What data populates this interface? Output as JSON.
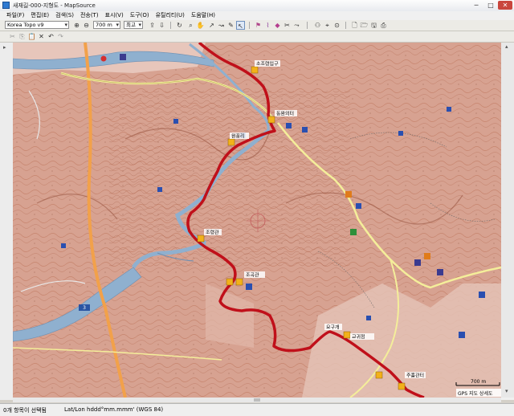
{
  "window": {
    "title": "새재길-000-지형도 - MapSource",
    "min": "─",
    "max": "□",
    "close": "✕"
  },
  "menu": [
    "파일(F)",
    "편집(E)",
    "검색(S)",
    "전송(T)",
    "표시(V)",
    "도구(O)",
    "유틸리티(U)",
    "도움말(H)"
  ],
  "toolbar": {
    "map_product": "Korea Topo v9",
    "zoom": "700 m",
    "detail": "최고"
  },
  "map": {
    "labels": {
      "l1": "소조령입구",
      "l2": "동완의터",
      "l3": "원풍리",
      "l4": "조령관",
      "l5": "조곡관",
      "l6": "교귀정",
      "l7": "주흘관터",
      "l8": "요구개",
      "road": "3"
    },
    "scale_text": "700 m",
    "attribution": "GPS 지도 상세도"
  },
  "status": {
    "selected": "0개 항목이 선택됨",
    "coords": "Lat/Lon hddd°mm.mmm' (WGS 84)"
  },
  "icons": [
    "app-icon",
    "zoom-in-icon",
    "zoom-out-icon",
    "select-icon",
    "hand-icon",
    "pencil-icon",
    "new-icon",
    "open-icon",
    "save-icon",
    "print-icon"
  ]
}
